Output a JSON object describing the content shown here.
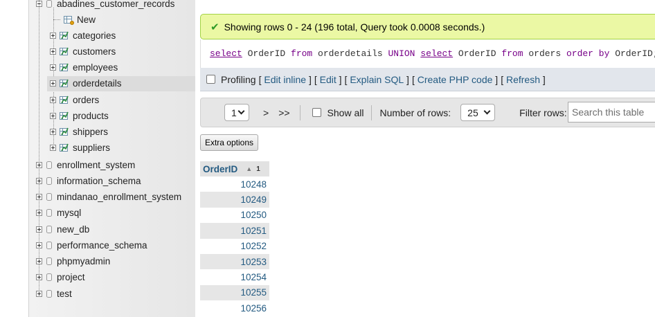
{
  "nav": {
    "top_db": "abadines_customer_records",
    "new_label": "New",
    "tables": [
      "categories",
      "customers",
      "employees",
      "orderdetails",
      "orders",
      "products",
      "shippers",
      "suppliers"
    ],
    "active_table": "orderdetails",
    "databases": [
      "enrollment_system",
      "information_schema",
      "mindanao_enrollment_system",
      "mysql",
      "new_db",
      "performance_schema",
      "phpmyadmin",
      "project",
      "test"
    ]
  },
  "success": {
    "message": "Showing rows 0 - 24 (196 total, Query took 0.0008 seconds.)"
  },
  "sql": {
    "tokens": [
      {
        "t": "select",
        "k": "kw u"
      },
      {
        "t": " OrderID ",
        "k": "tok"
      },
      {
        "t": "from",
        "k": "kw"
      },
      {
        "t": " orderdetails ",
        "k": "tok"
      },
      {
        "t": "UNION",
        "k": "kw"
      },
      {
        "t": " ",
        "k": "tok"
      },
      {
        "t": "select",
        "k": "kw u"
      },
      {
        "t": " OrderID ",
        "k": "tok"
      },
      {
        "t": "from",
        "k": "kw"
      },
      {
        "t": " orders ",
        "k": "tok"
      },
      {
        "t": "order by",
        "k": "kw"
      },
      {
        "t": " OrderID;",
        "k": "tok"
      }
    ]
  },
  "profiling": {
    "label": "Profiling",
    "links": [
      "Edit inline",
      "Edit",
      "Explain SQL",
      "Create PHP code",
      "Refresh"
    ]
  },
  "navigation": {
    "page_value": "1",
    "next_label": ">",
    "last_label": ">>",
    "show_all_label": "Show all",
    "rows_label": "Number of rows:",
    "rows_value": "25",
    "filter_label": "Filter rows:",
    "search_placeholder": "Search this table"
  },
  "extra_options_label": "Extra options",
  "results": {
    "column": "OrderID",
    "sort_order": "1",
    "rows": [
      "10248",
      "10249",
      "10250",
      "10251",
      "10252",
      "10253",
      "10254",
      "10255",
      "10256"
    ]
  }
}
